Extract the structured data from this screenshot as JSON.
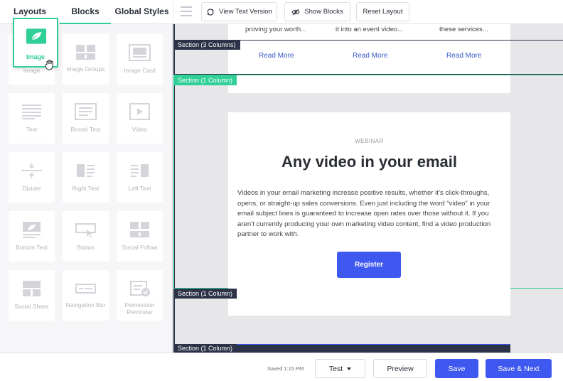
{
  "left_tabs": {
    "layouts": "Layouts",
    "blocks": "Blocks",
    "global_styles": "Global Styles"
  },
  "blocks": [
    {
      "name": "image",
      "label": "Image",
      "icon": "image-icon"
    },
    {
      "name": "image-groups",
      "label": "Image Groups",
      "icon": "image-groups-icon"
    },
    {
      "name": "image-card",
      "label": "Image Card",
      "icon": "image-card-icon"
    },
    {
      "name": "text",
      "label": "Text",
      "icon": "text-icon"
    },
    {
      "name": "boxed-text",
      "label": "Boxed Text",
      "icon": "boxed-text-icon"
    },
    {
      "name": "video",
      "label": "Video",
      "icon": "video-icon"
    },
    {
      "name": "divider",
      "label": "Divider",
      "icon": "divider-icon"
    },
    {
      "name": "right-text",
      "label": "Right Text",
      "icon": "right-text-icon"
    },
    {
      "name": "left-text",
      "label": "Left Text",
      "icon": "left-text-icon"
    },
    {
      "name": "bottom-text",
      "label": "Bottom Text",
      "icon": "bottom-text-icon"
    },
    {
      "name": "button",
      "label": "Button",
      "icon": "button-icon"
    },
    {
      "name": "social-follow",
      "label": "Social Follow",
      "icon": "social-follow-icon"
    },
    {
      "name": "social-share",
      "label": "Social Share",
      "icon": "social-share-icon"
    },
    {
      "name": "navigation-bar",
      "label": "Navigation Bar",
      "icon": "navigation-bar-icon"
    },
    {
      "name": "permission-reminder",
      "label": "Permission Reminder",
      "icon": "permission-reminder-icon"
    }
  ],
  "drag_ghost": {
    "label": "Image",
    "icon": "image-icon"
  },
  "toolbar": {
    "view_text_version": "View Text Version",
    "show_blocks": "Show Blocks",
    "reset_layout": "Reset Layout"
  },
  "canvas": {
    "columns_text": [
      "proving your worth...",
      "it into an event video...",
      "these services..."
    ],
    "read_more": [
      "Read More",
      "Read More",
      "Read More"
    ],
    "section_labels": {
      "three_columns": "Section (3 Columns)",
      "one_column_selected": "Section (1 Column)",
      "one_column_bottom": "Section (1 Column)",
      "one_column_footer": "Section (1 Column)"
    },
    "webinar": {
      "kicker": "WEBINAR",
      "title": "Any video in your email",
      "body": "Videos in your email marketing increase positive results, whether it’s click-throughs, opens, or straight-up sales conversions. Even just including the word “video” in your email subject lines is guaranteed to increase open rates over those without it. If you aren’t currently producing your own marketing video content, find a video production partner to work with.",
      "button": "Register"
    }
  },
  "bottom_bar": {
    "saved": "Saved 1:15 PM",
    "test": "Test",
    "preview": "Preview",
    "save": "Save",
    "save_next": "Save & Next"
  },
  "colors": {
    "accent_green": "#2fcf96",
    "primary_blue": "#3f58f0",
    "section_dark": "#2c3247",
    "link_blue": "#3a58c8"
  }
}
